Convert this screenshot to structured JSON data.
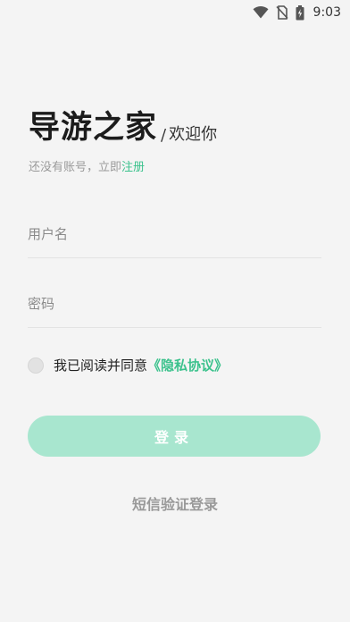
{
  "status_bar": {
    "time": "9:03",
    "icons": [
      "wifi-icon",
      "no-sim-icon",
      "battery-charging-icon"
    ]
  },
  "header": {
    "title": "导游之家",
    "slash": "/",
    "subtitle": "欢迎你"
  },
  "register": {
    "prompt": "还没有账号，立即",
    "link": "注册"
  },
  "form": {
    "username_placeholder": "用户名",
    "username_value": "",
    "password_placeholder": "密码",
    "password_value": ""
  },
  "agreement": {
    "checked": false,
    "text": "我已阅读并同意",
    "link": "《隐私协议》"
  },
  "login_button": "登录",
  "sms_login": "短信验证登录",
  "colors": {
    "background": "#f4f4f4",
    "accent": "#3cc28d",
    "button": "#a8e6cf",
    "secondary_text": "#999999"
  }
}
